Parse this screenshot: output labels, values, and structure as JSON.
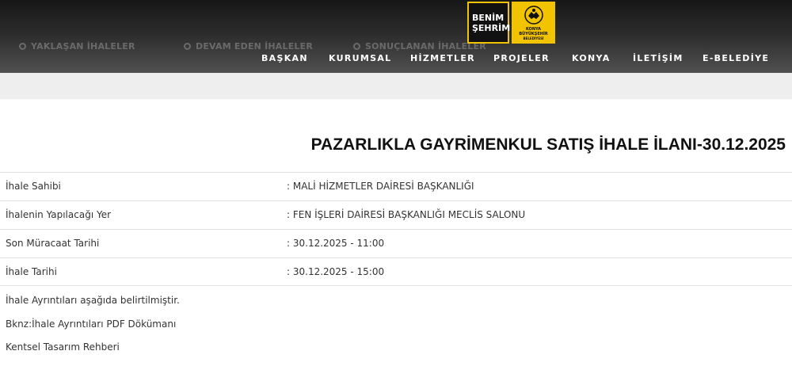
{
  "header": {
    "ghost_tabs": [
      "YAKLAŞAN İHALELER",
      "DEVAM EDEN İHALELER",
      "SONUÇLANAN İHALELER"
    ],
    "logo_benim": [
      "BENİM",
      "ŞEHRİM"
    ],
    "logo_konya": [
      "KONYA",
      "BÜYÜKŞEHİR",
      "BELEDİYESİ"
    ],
    "nav": [
      "BAŞKAN",
      "KURUMSAL",
      "HİZMETLER",
      "PROJELER",
      "KONYA",
      "İLETİŞİM",
      "E-BELEDİYE"
    ]
  },
  "page": {
    "title": "PAZARLIKLA GAYRİMENKUL SATIŞ İHALE İLANI-30.12.2025"
  },
  "details": [
    {
      "label": "İhale Sahibi",
      "value": ": MALİ HİZMETLER DAİRESİ BAŞKANLIĞI"
    },
    {
      "label": "İhalenin Yapılacağı Yer",
      "value": ": FEN İŞLERİ DAİRESİ BAŞKANLIĞI MECLİS SALONU"
    },
    {
      "label": "Son Müracaat Tarihi",
      "value": ": 30.12.2025 - 11:00"
    },
    {
      "label": "İhale Tarihi",
      "value": ": 30.12.2025 - 15:00"
    }
  ],
  "notes": [
    "İhale Ayrıntıları aşağıda belirtilmiştir.",
    "Bknz:İhale Ayrıntıları PDF Dökümanı",
    "Kentsel Tasarım Rehberi"
  ],
  "colors": {
    "header": "#2b2b2b",
    "accent": "#f2c300"
  }
}
